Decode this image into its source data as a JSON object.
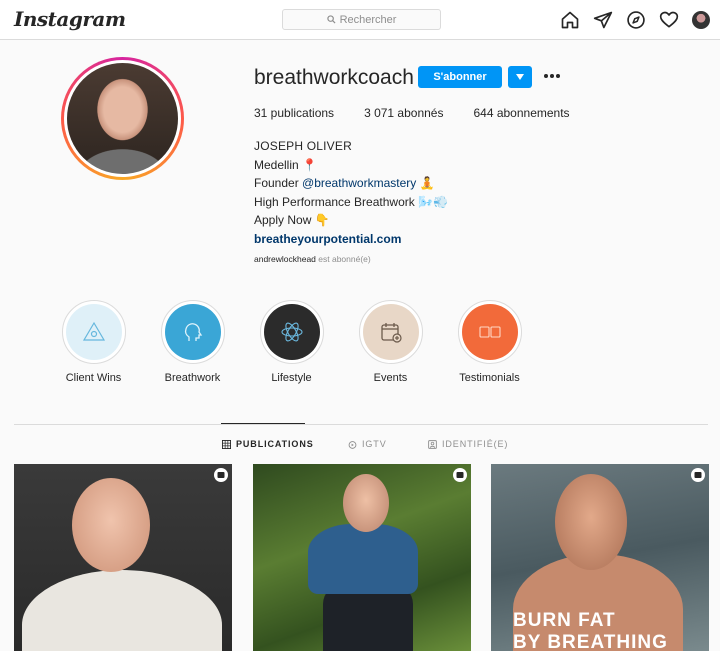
{
  "topbar": {
    "logo": "Instagram",
    "search_placeholder": "Rechercher",
    "icons": [
      "home-icon",
      "direct-icon",
      "explore-icon",
      "heart-icon",
      "profile-avatar"
    ]
  },
  "profile": {
    "username": "breathworkcoach",
    "follow_label": "S'abonner",
    "stats": {
      "posts": "31 publications",
      "followers": "3 071 abonnés",
      "following": "644 abonnements"
    },
    "bio": {
      "name": "JOSEPH OLIVER",
      "line1": "Medellin 📍",
      "founder_prefix": "Founder ",
      "founder_mention": "@breathworkmastery",
      "founder_suffix": " 🧘",
      "line3": "High Performance Breathwork 🌬️💨",
      "line4": "Apply Now 👇",
      "link": "breatheyourpotential.com"
    },
    "followed_by_user": "andrewlockhead",
    "followed_by_suffix": " est abonné(e)"
  },
  "highlights": [
    {
      "label": "Client Wins",
      "color": "#dff0f8"
    },
    {
      "label": "Breathwork",
      "color": "#3aa6d6"
    },
    {
      "label": "Lifestyle",
      "color": "#2b2b2b"
    },
    {
      "label": "Events",
      "color": "#e8d7c7"
    },
    {
      "label": "Testimonials",
      "color": "#f26a3a"
    }
  ],
  "tabs": {
    "publications": "PUBLICATIONS",
    "igtv": "IGTV",
    "tagged": "IDENTIFIÉ(E)"
  },
  "posts": [
    {
      "overlay_text": ""
    },
    {
      "overlay_text": ""
    },
    {
      "overlay_text_1": "BURN FAT",
      "overlay_text_2": "BY BREATHING"
    }
  ],
  "colors": {
    "accent": "#0095f6",
    "link": "#00376b",
    "muted": "#8e8e8e"
  }
}
